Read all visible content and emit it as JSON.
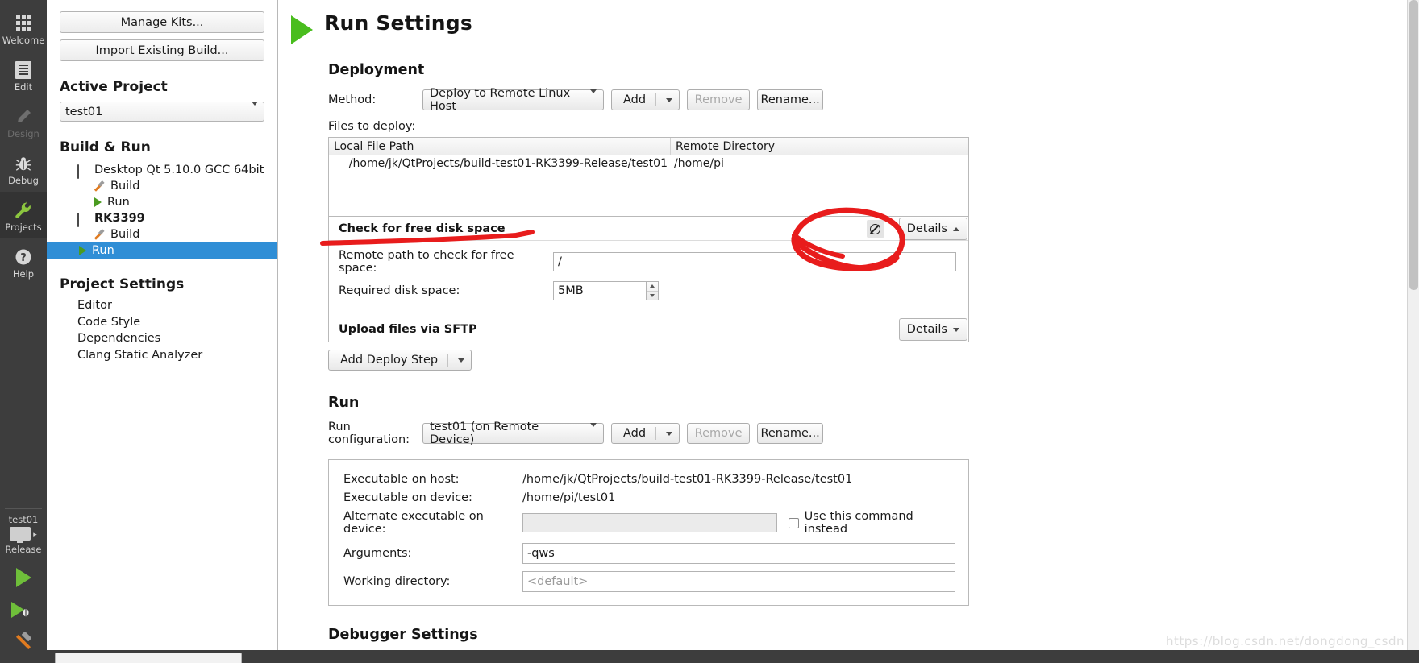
{
  "modebar": {
    "items": [
      {
        "label": "Welcome",
        "icon": "grid-icon",
        "state": "normal"
      },
      {
        "label": "Edit",
        "icon": "document-icon",
        "state": "normal"
      },
      {
        "label": "Design",
        "icon": "pencil-icon",
        "state": "disabled"
      },
      {
        "label": "Debug",
        "icon": "bug-icon",
        "state": "normal"
      },
      {
        "label": "Projects",
        "icon": "wrench-icon",
        "state": "active"
      },
      {
        "label": "Help",
        "icon": "question-mark-icon",
        "state": "normal"
      }
    ],
    "kit_selector": {
      "project": "test01",
      "build_config": "Release",
      "icon": "monitor-icon",
      "arrow": "▸"
    },
    "actions": [
      {
        "name": "run-button",
        "icon": "play-icon"
      },
      {
        "name": "debug-button",
        "icon": "play-bug-icon"
      },
      {
        "name": "build-button",
        "icon": "hammer-icon"
      }
    ]
  },
  "projectpane": {
    "manage_kits_label": "Manage Kits...",
    "import_build_label": "Import Existing Build...",
    "active_project_heading": "Active Project",
    "active_project_value": "test01",
    "build_run_heading": "Build & Run",
    "tree": [
      {
        "label": "Desktop Qt 5.10.0 GCC 64bit",
        "icon": "monitor-icon",
        "level": 1,
        "bold": false,
        "selected": false
      },
      {
        "label": "Build",
        "icon": "hammer-icon",
        "level": 2,
        "bold": false,
        "selected": false
      },
      {
        "label": "Run",
        "icon": "play-icon",
        "level": 2,
        "bold": false,
        "selected": false
      },
      {
        "label": "RK3399",
        "icon": "monitor-icon",
        "level": 1,
        "bold": true,
        "selected": false
      },
      {
        "label": "Build",
        "icon": "hammer-icon",
        "level": 2,
        "bold": false,
        "selected": false
      },
      {
        "label": "Run",
        "icon": "play-icon",
        "level": 2,
        "bold": false,
        "selected": true
      }
    ],
    "project_settings_heading": "Project Settings",
    "settings": [
      {
        "label": "Editor"
      },
      {
        "label": "Code Style"
      },
      {
        "label": "Dependencies"
      },
      {
        "label": "Clang Static Analyzer"
      }
    ]
  },
  "main": {
    "page_title": "Run Settings",
    "deployment": {
      "heading": "Deployment",
      "method_label": "Method:",
      "method_value": "Deploy to Remote Linux Host",
      "add_label": "Add",
      "remove_label": "Remove",
      "rename_label": "Rename...",
      "files_label": "Files to deploy:",
      "table": {
        "columns": [
          "Local File Path",
          "Remote Directory"
        ],
        "rows": [
          [
            "/home/jk/QtProjects/build-test01-RK3399-Release/test01",
            "/home/pi"
          ]
        ]
      },
      "steps": [
        {
          "title": "Check for free disk space",
          "details_label": "Details",
          "details_state": "expanded",
          "disable_icon": "no-entry-icon",
          "fields": [
            {
              "label": "Remote path to check for free space:",
              "value": "/",
              "type": "text"
            },
            {
              "label": "Required disk space:",
              "value": "5MB",
              "type": "spinbox"
            }
          ]
        },
        {
          "title": "Upload files via SFTP",
          "details_label": "Details",
          "details_state": "collapsed",
          "fields": []
        }
      ],
      "add_deploy_step_label": "Add Deploy Step"
    },
    "run": {
      "heading": "Run",
      "config_label": "Run configuration:",
      "config_value": "test01 (on Remote Device)",
      "add_label": "Add",
      "remove_label": "Remove",
      "rename_label": "Rename...",
      "fields": [
        {
          "label": "Executable on host:",
          "value": "/home/jk/QtProjects/build-test01-RK3399-Release/test01",
          "type": "static"
        },
        {
          "label": "Executable on device:",
          "value": "/home/pi/test01",
          "type": "static"
        },
        {
          "label": "Alternate executable on device:",
          "value": "",
          "type": "text-disabled",
          "checkbox_label": "Use this command instead",
          "checked": false
        },
        {
          "label": "Arguments:",
          "value": "-qws",
          "type": "text"
        },
        {
          "label": "Working directory:",
          "value": "",
          "placeholder": "<default>",
          "type": "text"
        }
      ]
    },
    "debugger": {
      "heading": "Debugger Settings"
    }
  },
  "annotation": {
    "color": "#e81c1c",
    "shapes": [
      "circle-around-disable-icon",
      "underline-under-step-title"
    ]
  },
  "watermark": {
    "text": "https://blog.csdn.net/dongdong_csdn"
  },
  "colors": {
    "accent_blue": "#2f8ed6",
    "green": "#49bd1e",
    "modebar_bg": "#3d3d3d",
    "annotation_red": "#e81c1c"
  }
}
